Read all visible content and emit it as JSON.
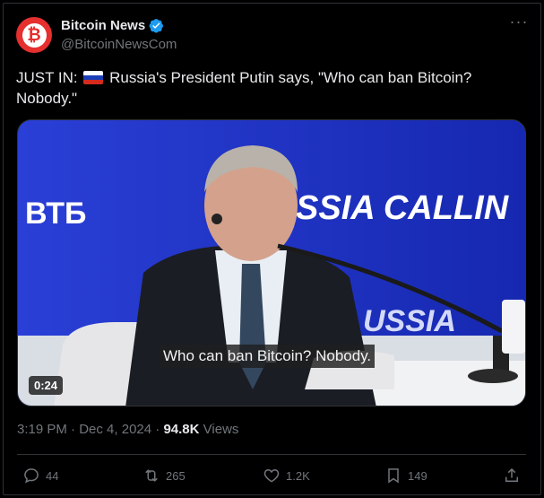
{
  "author": {
    "display_name": "Bitcoin News",
    "handle": "@BitcoinNewsCom",
    "avatar_glyph": "₿",
    "verified_color": "#1d9bf0"
  },
  "menu": {
    "more_label": "···"
  },
  "tweet": {
    "prefix": "JUST IN:",
    "flag_icon": "russia-flag-icon",
    "text": "Russia's President Putin says, \"Who can ban Bitcoin? Nobody.\""
  },
  "media": {
    "type": "video",
    "backdrop_logo": "ВТБ",
    "backdrop_banner_1": "SSIA CALLIN",
    "backdrop_banner_2": "USSIA",
    "caption": "Who can ban Bitcoin? Nobody.",
    "duration": "0:24"
  },
  "meta": {
    "time": "3:19 PM",
    "separator": "·",
    "date": "Dec 4, 2024",
    "views_count": "94.8K",
    "views_label": "Views"
  },
  "actions": {
    "replies": "44",
    "reposts": "265",
    "likes": "1.2K",
    "bookmarks": "149"
  },
  "colors": {
    "background": "#000000",
    "text": "#e7e9ea",
    "muted": "#71767b",
    "border": "#2f3336",
    "brand": "#e5302f"
  }
}
